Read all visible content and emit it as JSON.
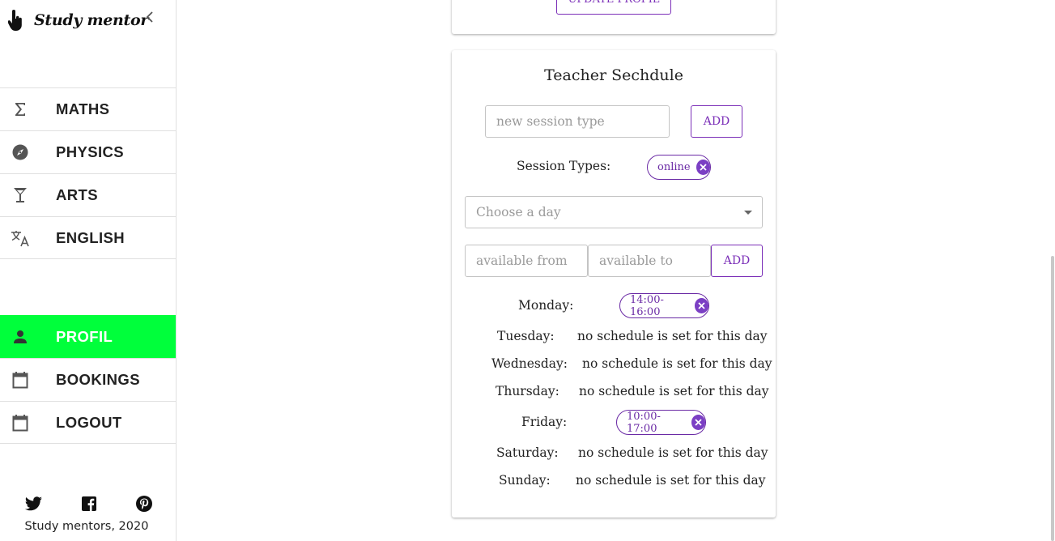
{
  "brand": {
    "title": "Study mentor",
    "logo_icon": "hand-pointer-icon"
  },
  "nav_top": [
    {
      "label": "MATHS",
      "icon": "sigma-icon"
    },
    {
      "label": "PHYSICS",
      "icon": "compass-icon"
    },
    {
      "label": "ARTS",
      "icon": "cocktail-glass-icon"
    },
    {
      "label": "ENGLISH",
      "icon": "translate-icon"
    }
  ],
  "nav_bottom": [
    {
      "label": "PROFIL",
      "icon": "person-icon",
      "active": true
    },
    {
      "label": "BOOKINGS",
      "icon": "calendar-icon"
    },
    {
      "label": "LOGOUT",
      "icon": "calendar-icon"
    }
  ],
  "footer": {
    "text": "Study mentors, 2020",
    "social": [
      "twitter-icon",
      "facebook-icon",
      "pinterest-icon"
    ]
  },
  "profile_card": {
    "update_label": "UPDATE PROFIL"
  },
  "schedule": {
    "title": "Teacher Sechdule",
    "session_input_placeholder": "new session type",
    "add_session_label": "ADD",
    "session_types_label": "Session Types:",
    "session_types": [
      "online"
    ],
    "day_select_placeholder": "Choose a day",
    "from_placeholder": "available from",
    "to_placeholder": "available to",
    "add_slot_label": "ADD",
    "days": [
      {
        "day": "Monday:",
        "slot": "14:00-16:00"
      },
      {
        "day": "Tuesday:",
        "empty": "no schedule is set for this day"
      },
      {
        "day": "Wednesday:",
        "empty": "no schedule is set for this day"
      },
      {
        "day": "Thursday:",
        "empty": "no schedule is set for this day"
      },
      {
        "day": "Friday:",
        "slot": "10:00-17:00"
      },
      {
        "day": "Saturday:",
        "empty": "no schedule is set for this day"
      },
      {
        "day": "Sunday:",
        "empty": "no schedule is set for this day"
      }
    ]
  },
  "colors": {
    "accent": "#7b2fb8",
    "active_nav": "#00ff3b"
  }
}
